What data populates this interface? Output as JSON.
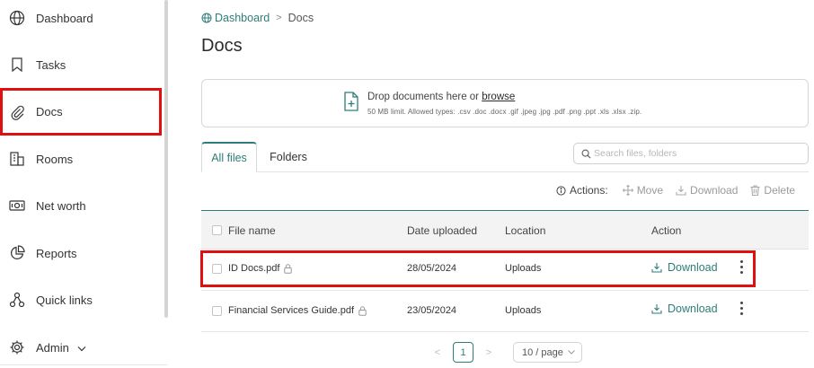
{
  "sidebar": {
    "items": [
      {
        "label": "Dashboard",
        "icon": "globe-icon"
      },
      {
        "label": "Tasks",
        "icon": "bookmark-icon"
      },
      {
        "label": "Docs",
        "icon": "paperclip-icon",
        "active": true
      },
      {
        "label": "Rooms",
        "icon": "building-icon"
      },
      {
        "label": "Net worth",
        "icon": "money-icon"
      },
      {
        "label": "Reports",
        "icon": "pie-chart-icon"
      },
      {
        "label": "Quick links",
        "icon": "links-icon"
      },
      {
        "label": "Admin",
        "icon": "gear-icon"
      }
    ]
  },
  "breadcrumb": {
    "parent": "Dashboard",
    "separator": ">",
    "current": "Docs"
  },
  "page_title": "Docs",
  "upload": {
    "prefix": "Drop documents here or ",
    "link": "browse",
    "limits": "50 MB limit. Allowed types: .csv .doc .docx .gif .jpeg .jpg .pdf .png .ppt .xls .xlsx .zip."
  },
  "tabs": [
    {
      "label": "All files",
      "active": true
    },
    {
      "label": "Folders",
      "active": false
    }
  ],
  "search": {
    "placeholder": "Search files, folders",
    "value": ""
  },
  "actions": {
    "label": "Actions:",
    "move": "Move",
    "download": "Download",
    "delete": "Delete"
  },
  "table": {
    "headers": [
      "File name",
      "Date uploaded",
      "Location",
      "Action"
    ],
    "rows": [
      {
        "name": "ID Docs.pdf",
        "date": "28/05/2024",
        "location": "Uploads",
        "action": "Download"
      },
      {
        "name": "Financial Services Guide.pdf",
        "date": "23/05/2024",
        "location": "Uploads",
        "action": "Download"
      }
    ]
  },
  "pagination": {
    "current": "1",
    "page_size": "10 / page",
    "prev": "<",
    "next": ">"
  },
  "colors": {
    "accent": "#2e7d7a",
    "highlight": "#e01010"
  }
}
